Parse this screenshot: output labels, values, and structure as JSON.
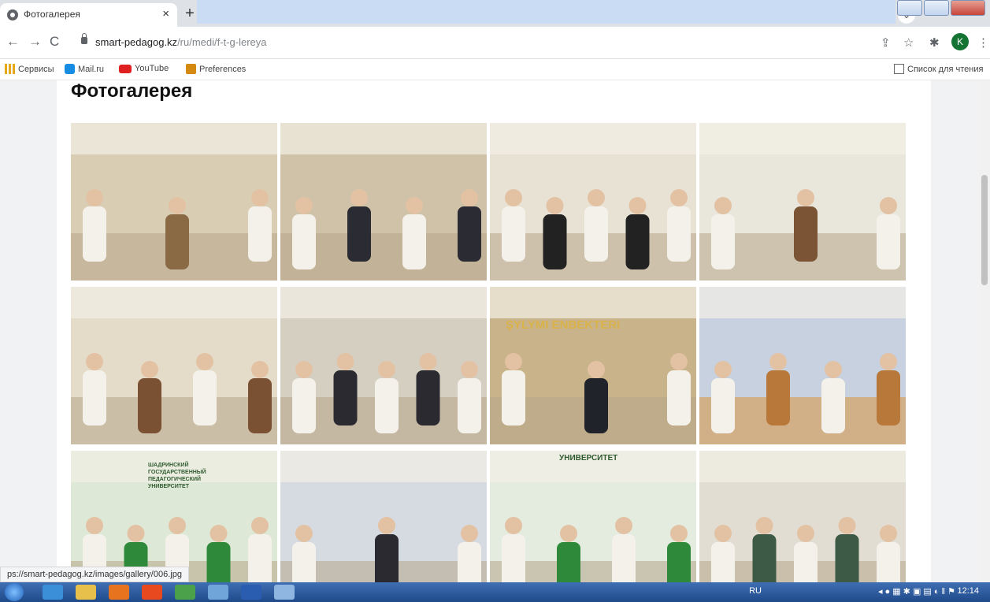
{
  "browser": {
    "tab_title": "Фотогалерея",
    "tab_close": "×",
    "new_tab": "+",
    "tab_search_icon": "chevron-down",
    "url_host": "smart-pedagog.kz",
    "url_path": "/ru/medi/f-t-g-lereya",
    "back_glyph": "←",
    "forward_glyph": "→",
    "reload_glyph": "C",
    "share_glyph": "⇪",
    "star_glyph": "☆",
    "ext_glyph": "✱",
    "menu_glyph": "⋮",
    "avatar_letter": "K",
    "bookmarks": [
      "Сервисы",
      "Mail.ru",
      "YouTube",
      "Preferences"
    ],
    "reading_list": "Список для чтения"
  },
  "page": {
    "title": "Фотогалерея",
    "status_url": "ps://smart-pedagog.kz/images/gallery/006.jpg"
  },
  "gallery": {
    "photos": [
      {
        "scene": "library-workshop",
        "bg": "#d9cdb4",
        "accent": "#8a6a45"
      },
      {
        "scene": "table-group-work",
        "bg": "#cfc2a8",
        "accent": "#2b2b33"
      },
      {
        "scene": "presentation-poster",
        "bg": "#e8e2d4",
        "accent": "#222"
      },
      {
        "scene": "classroom-presenters",
        "bg": "#e9e6dc",
        "accent": "#7a5434"
      },
      {
        "scene": "classroom-wide",
        "bg": "#e4dbc8",
        "accent": "#7a5233"
      },
      {
        "scene": "table-discussion",
        "bg": "#d5cfc2",
        "accent": "#2a2a30"
      },
      {
        "scene": "four-women-banner",
        "bg": "#c9b38a",
        "accent": "#20232a"
      },
      {
        "scene": "meeting-room",
        "bg": "#c8d1df",
        "accent": "#b8783a"
      },
      {
        "scene": "banner-group",
        "bg": "#dde8d6",
        "accent": "#2e8a3a"
      },
      {
        "scene": "office-group",
        "bg": "#d6dbe2",
        "accent": "#2a2a30"
      },
      {
        "scene": "award-handshake",
        "bg": "#e3ecdf",
        "accent": "#2e8a3a"
      },
      {
        "scene": "lecture-room",
        "bg": "#e1ddd2",
        "accent": "#3c5a45"
      }
    ],
    "banner_text_1": "ШАДРИНСКИЙ ГОСУДАРСТВЕННЫЙ ПЕДАГОГИЧЕСКИЙ УНИВЕРСИТЕТ",
    "banner_text_2": "УНИВЕРСИТЕТ",
    "wall_text": "ŞYLYMI ENBEKTERI"
  },
  "taskbar": {
    "lang": "RU",
    "time": "12:14"
  },
  "colors": {
    "tab_strip": "#dee1e6",
    "taskbar": "#1f4a8a"
  }
}
